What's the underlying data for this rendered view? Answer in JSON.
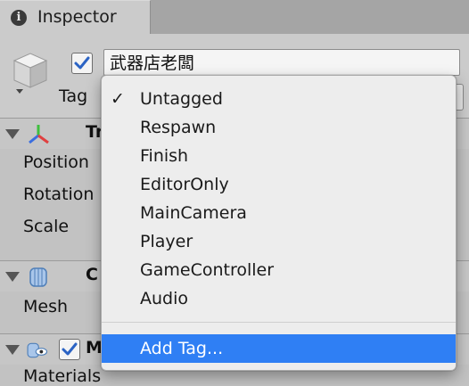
{
  "tab": {
    "title": "Inspector",
    "icon": "info-icon"
  },
  "object": {
    "name": "武器店老闆",
    "active": true
  },
  "tag": {
    "label": "Tag"
  },
  "components": [
    {
      "title": "Tr",
      "icon": "transform-axes-icon",
      "properties": [
        "Position",
        "Rotation",
        "Scale"
      ]
    },
    {
      "title": "C",
      "icon": "mesh-filter-icon",
      "properties": [
        "Mesh"
      ]
    },
    {
      "title": "M",
      "icon": "mesh-renderer-icon",
      "enabled": true,
      "properties": [
        "Materials"
      ]
    }
  ],
  "menu": {
    "selected": "Untagged",
    "items": [
      "Untagged",
      "Respawn",
      "Finish",
      "EditorOnly",
      "MainCamera",
      "Player",
      "GameController",
      "Audio"
    ],
    "add_tag": "Add Tag...",
    "check_glyph": "✓"
  },
  "colors": {
    "highlight": "#2f7ff4",
    "checkbox_blue": "#2b63c4"
  }
}
